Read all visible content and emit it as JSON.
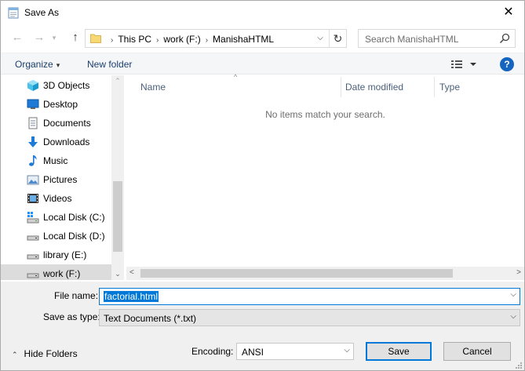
{
  "window": {
    "title": "Save As",
    "close_glyph": "✕"
  },
  "nav": {
    "back_glyph": "←",
    "forward_glyph": "→",
    "recent_glyph": "▾",
    "up_glyph": "↑",
    "breadcrumbs": [
      "This PC",
      "work (F:)",
      "ManishaHTML"
    ],
    "breadcrumb_sep": "›",
    "address_dropdown_glyph": "⌵",
    "refresh_glyph": "↻",
    "search_placeholder": "Search ManishaHTML"
  },
  "toolbar": {
    "organize_label": "Organize",
    "organize_caret": "▾",
    "new_folder_label": "New folder",
    "help_label": "?"
  },
  "sidebar": {
    "items": [
      {
        "label": "3D Objects",
        "icon": "cube-3d-icon"
      },
      {
        "label": "Desktop",
        "icon": "desktop-icon"
      },
      {
        "label": "Documents",
        "icon": "documents-icon"
      },
      {
        "label": "Downloads",
        "icon": "download-arrow-icon"
      },
      {
        "label": "Music",
        "icon": "music-note-icon"
      },
      {
        "label": "Pictures",
        "icon": "pictures-icon"
      },
      {
        "label": "Videos",
        "icon": "videos-icon"
      },
      {
        "label": "Local Disk (C:)",
        "icon": "system-drive-icon"
      },
      {
        "label": "Local Disk (D:)",
        "icon": "drive-icon"
      },
      {
        "label": "library (E:)",
        "icon": "drive-icon"
      },
      {
        "label": "work (F:)",
        "icon": "drive-icon",
        "selected": true
      }
    ],
    "scroll_down_glyph": "⌄",
    "scroll_up_glyph": "⌃"
  },
  "filelist": {
    "columns": [
      "Name",
      "Date modified",
      "Type"
    ],
    "sort_glyph": "^",
    "empty_message": "No items match your search.",
    "scroll_left_glyph": "<",
    "scroll_right_glyph": ">"
  },
  "form": {
    "file_name_label": "File name:",
    "file_name_value": "factorial.html",
    "save_as_type_label": "Save as type:",
    "save_as_type_value": "Text Documents (*.txt)",
    "dropdown_glyph": "⌵",
    "hide_folders_label": "Hide Folders",
    "hide_folders_glyph": "⌃",
    "encoding_label": "Encoding:",
    "encoding_value": "ANSI",
    "save_label": "Save",
    "cancel_label": "Cancel"
  },
  "colors": {
    "accent": "#0078d7",
    "help_badge": "#1565c0",
    "folder_yellow": "#f8d775"
  }
}
